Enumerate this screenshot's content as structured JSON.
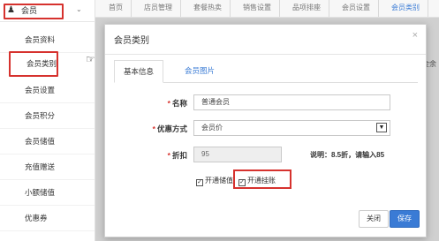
{
  "sidebar": {
    "header_label": "会员",
    "items": [
      {
        "label": "会员资料"
      },
      {
        "label": "会员类别"
      },
      {
        "label": "会员设置"
      },
      {
        "label": "会员积分"
      },
      {
        "label": "会员储值"
      },
      {
        "label": "充值赠送"
      },
      {
        "label": "小额储值"
      },
      {
        "label": "优惠券"
      }
    ]
  },
  "topbar": {
    "tabs": [
      {
        "label": "首页"
      },
      {
        "label": "店员管理"
      },
      {
        "label": "套餐热卖"
      },
      {
        "label": "销售设置"
      },
      {
        "label": "品项排座"
      },
      {
        "label": "会员设置"
      },
      {
        "label": "会员类别"
      }
    ],
    "active_index": 6
  },
  "background_right_text": "金余",
  "modal": {
    "title": "会员类别",
    "close_glyph": "×",
    "tabs": [
      {
        "label": "基本信息"
      },
      {
        "label": "会员图片"
      }
    ],
    "fields": {
      "name": {
        "label": "名称",
        "value": "普通会员"
      },
      "discount_method": {
        "label": "优惠方式",
        "value": "会员价"
      },
      "discount": {
        "label": "折扣",
        "value": "95",
        "hint": "说明：8.5折，请输入85"
      }
    },
    "checkboxes": [
      {
        "label": "开通储值",
        "checked": true
      },
      {
        "label": "开通挂账",
        "checked": true
      }
    ],
    "buttons": {
      "close": "关闭",
      "save": "保存"
    }
  },
  "colors": {
    "accent": "#3a7bd5",
    "highlight": "#d6322e"
  }
}
